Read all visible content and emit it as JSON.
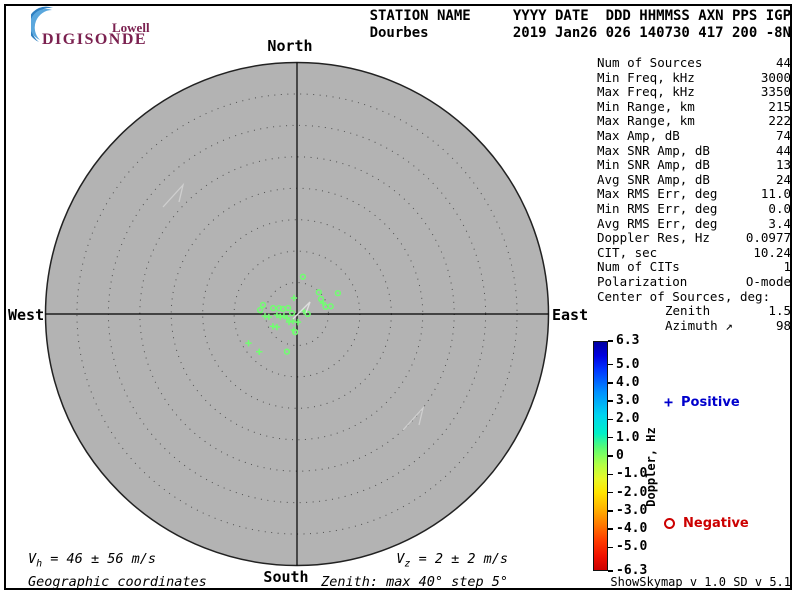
{
  "logo": {
    "line1": "Lowell",
    "line2": "DIGISONDE"
  },
  "header": {
    "row1": "STATION NAME     YYYY DATE  DDD HHMMSS AXN PPS IGP",
    "row2": "Dourbes          2019 Jan26 026 140730 417 200 -8N"
  },
  "compass": {
    "north": "North",
    "south": "South",
    "west": "West",
    "east": "East"
  },
  "stats": {
    "rows": [
      {
        "label": "Num of Sources",
        "value": "44"
      },
      {
        "label": "Min Freq, kHz",
        "value": "3000"
      },
      {
        "label": "Max Freq, kHz",
        "value": "3350"
      },
      {
        "label": "Min Range, km",
        "value": "215"
      },
      {
        "label": "Max Range, km",
        "value": "222"
      },
      {
        "label": "Max Amp, dB",
        "value": "74"
      },
      {
        "label": "Max SNR Amp, dB",
        "value": "44"
      },
      {
        "label": "Min SNR Amp, dB",
        "value": "13"
      },
      {
        "label": "Avg SNR Amp, dB",
        "value": "24"
      },
      {
        "label": "Max RMS Err, deg",
        "value": "11.0"
      },
      {
        "label": "Min RMS Err, deg",
        "value": "0.0"
      },
      {
        "label": "Avg RMS Err, deg",
        "value": "3.4"
      },
      {
        "label": "Doppler Res, Hz",
        "value": "0.0977"
      },
      {
        "label": "CIT, sec",
        "value": "10.24"
      },
      {
        "label": "Num of CITs",
        "value": "1"
      },
      {
        "label": "Polarization",
        "value": "O-mode"
      }
    ],
    "center_heading": "Center of Sources, deg:",
    "center_rows": [
      {
        "label": "Zenith",
        "value": "1.5"
      },
      {
        "label": "Azimuth ↗",
        "value": "98"
      }
    ]
  },
  "colorbar": {
    "title": "Doppler, Hz",
    "max": 6.3,
    "min": -6.3,
    "ticks": [
      "6.3",
      "5.0",
      "4.0",
      "3.0",
      "2.0",
      "1.0",
      "0",
      "-1.0",
      "-2.0",
      "-3.0",
      "-4.0",
      "-5.0",
      "-6.3"
    ]
  },
  "legend": {
    "positive_marker": "+",
    "positive_label": "Positive",
    "negative_marker": "o",
    "negative_label": "Negative"
  },
  "footer": {
    "vh_sym": "V",
    "vh_sub": "h",
    "vh_rest": " = 46 ± 56 m/s",
    "coords": "Geographic coordinates",
    "vz_sym": "V",
    "vz_sub": "z",
    "vz_rest": " = 2 ± 2 m/s",
    "zenith_info": "Zenith: max 40°  step 5°",
    "credit": "ShowSkymap v 1.0  SD v 5.1"
  },
  "colors": {
    "marker_green": "#70ff70",
    "sky_fill": "#b3b3b3",
    "positive_blue": "#0000cc",
    "negative_red": "#cc0000",
    "logo_maroon": "#7b2150",
    "crescent_blue": "#2e7fc0"
  },
  "chart_data": {
    "type": "scatter",
    "projection": "polar_skymap",
    "title": "Skymap of ionospheric sources, Dourbes, 2019 Jan26 14:07:30 UT",
    "zenith_max_deg": 40,
    "zenith_ring_step_deg": 5,
    "compass_labels": [
      "North",
      "East",
      "South",
      "West"
    ],
    "colorbar": {
      "label": "Doppler, Hz",
      "min": -6.3,
      "max": 6.3
    },
    "num_sources": 44,
    "center_of_sources_deg": {
      "zenith": 1.5,
      "azimuth": 98
    },
    "series": [
      {
        "name": "Positive Doppler",
        "marker": "plus",
        "approx_doppler_hz": 0.4,
        "points": [
          {
            "zen": 2.6,
            "az": 349
          },
          {
            "zen": 4.5,
            "az": 67
          },
          {
            "zen": 1.2,
            "az": 67
          },
          {
            "zen": 5.1,
            "az": 266
          },
          {
            "zen": 4.5,
            "az": 264
          },
          {
            "zen": 3.2,
            "az": 267
          },
          {
            "zen": 2.7,
            "az": 260
          },
          {
            "zen": 2.1,
            "az": 261
          },
          {
            "zen": 1.7,
            "az": 248
          },
          {
            "zen": 4.3,
            "az": 243
          },
          {
            "zen": 3.8,
            "az": 237
          },
          {
            "zen": 1.8,
            "az": 225
          },
          {
            "zen": 1.3,
            "az": 210
          },
          {
            "zen": 1.3,
            "az": 173
          },
          {
            "zen": 2.6,
            "az": 191
          },
          {
            "zen": 9.0,
            "az": 239
          },
          {
            "zen": 8.5,
            "az": 225
          }
        ]
      },
      {
        "name": "Negative Doppler",
        "marker": "ring",
        "approx_doppler_hz": -0.4,
        "points": [
          {
            "zen": 6.0,
            "az": 9
          },
          {
            "zen": 4.9,
            "az": 45
          },
          {
            "zen": 7.3,
            "az": 63
          },
          {
            "zen": 4.5,
            "az": 58
          },
          {
            "zen": 4.7,
            "az": 76
          },
          {
            "zen": 5.5,
            "az": 77
          },
          {
            "zen": 5.6,
            "az": 285
          },
          {
            "zen": 3.9,
            "az": 284
          },
          {
            "zen": 3.0,
            "az": 288
          },
          {
            "zen": 2.4,
            "az": 290
          },
          {
            "zen": 1.7,
            "az": 304
          },
          {
            "zen": 0.8,
            "az": 281
          },
          {
            "zen": 1.7,
            "az": 90
          },
          {
            "zen": 2.9,
            "az": 186
          },
          {
            "zen": 6.2,
            "az": 195
          },
          {
            "zen": 5.9,
            "az": 276
          }
        ]
      }
    ]
  }
}
